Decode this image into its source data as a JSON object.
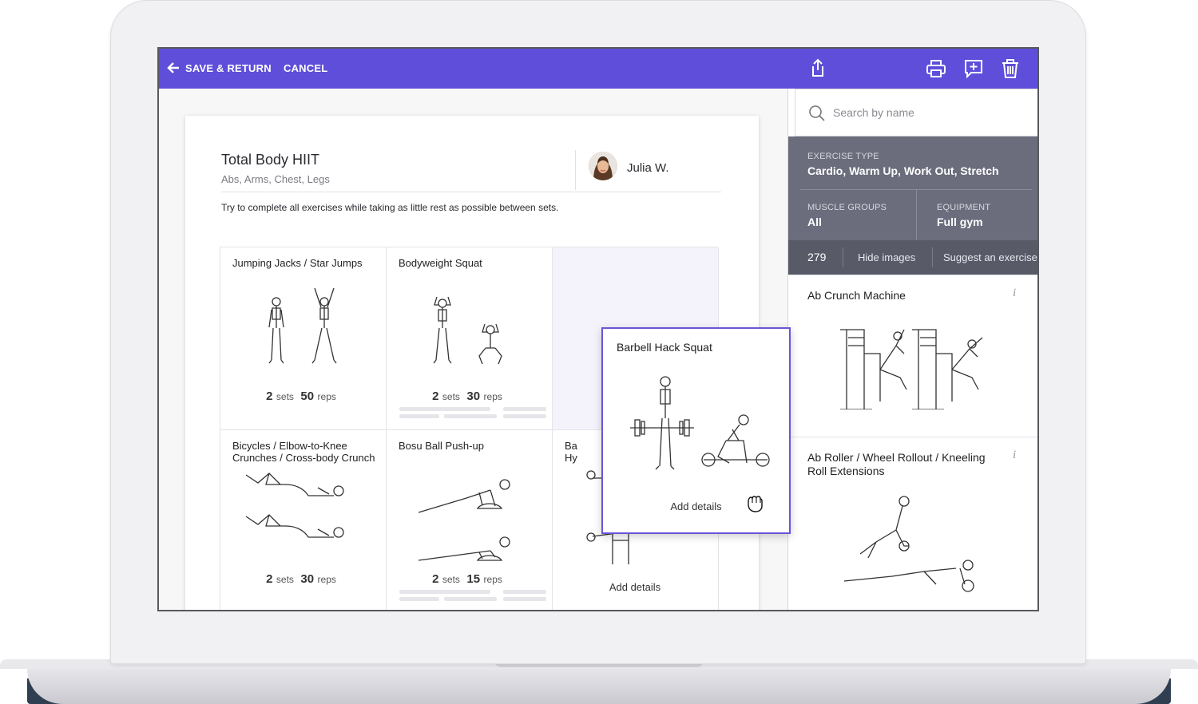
{
  "toolbar": {
    "save_return_label": "SAVE & RETURN",
    "cancel_label": "CANCEL",
    "icons": [
      "arrow-left-icon",
      "share-icon",
      "print-icon",
      "add-note-icon",
      "trash-icon"
    ]
  },
  "workout": {
    "title": "Total Body HIIT",
    "muscles": "Abs, Arms, Chest, Legs",
    "author": "Julia W.",
    "description": "Try to complete all exercises while taking as little rest as possible between sets."
  },
  "exercises": [
    {
      "name": "Jumping Jacks / Star Jumps",
      "sets": "2",
      "sets_unit": "sets",
      "reps": "50",
      "reps_unit": "reps"
    },
    {
      "name": "Bodyweight Squat",
      "sets": "2",
      "sets_unit": "sets",
      "reps": "30",
      "reps_unit": "reps"
    },
    {
      "name": "Bicycles / Elbow-to-Knee Crunches / Cross-body Crunch",
      "sets": "2",
      "sets_unit": "sets",
      "reps": "30",
      "reps_unit": "reps"
    },
    {
      "name": "Bosu Ball Push-up",
      "sets": "2",
      "sets_unit": "sets",
      "reps": "15",
      "reps_unit": "reps"
    },
    {
      "name": "Ba",
      "name_line2": "Hy",
      "details_label": "Add details"
    }
  ],
  "dragging": {
    "name": "Barbell Hack Squat",
    "details_label": "Add details",
    "cursor_icon": "grab-hand-icon"
  },
  "sidebar": {
    "search_placeholder": "Search by name",
    "exercise_type_label": "EXERCISE TYPE",
    "exercise_type_value": "Cardio, Warm Up, Work Out, Stretch",
    "muscle_groups_label": "MUSCLE GROUPS",
    "muscle_groups_value": "All",
    "equipment_label": "EQUIPMENT",
    "equipment_value": "Full gym",
    "count": "279",
    "hide_images_label": "Hide images",
    "suggest_label": "Suggest an exercise",
    "results": [
      {
        "name": "Ab Crunch Machine",
        "info": "i"
      },
      {
        "name": "Ab Roller / Wheel Rollout / Kneeling Roll Extensions",
        "info": "i"
      }
    ]
  },
  "colors": {
    "accent": "#5e4ed9",
    "filter_bg": "#6b6d7c",
    "stat_bg": "#585a68",
    "drag_border": "#6a54d8"
  }
}
